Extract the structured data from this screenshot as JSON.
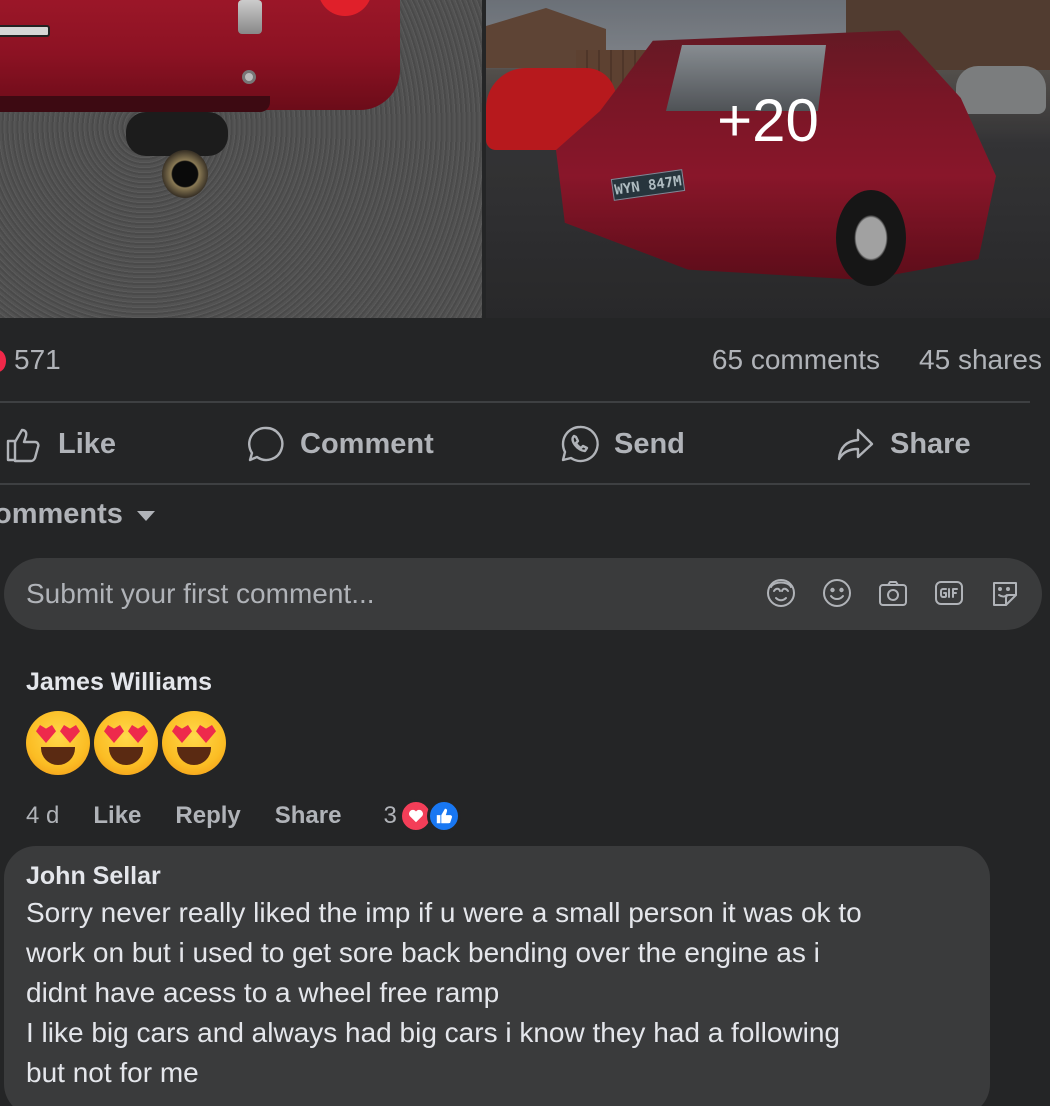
{
  "post": {
    "photos": {
      "more_label": "+20",
      "plate_text": "WYN 847M"
    },
    "stats": {
      "reactions": "571",
      "comments": "65 comments",
      "shares": "45 shares"
    },
    "actions": {
      "like": "Like",
      "comment": "Comment",
      "send": "Send",
      "share": "Share"
    },
    "sort_label": "omments",
    "composer": {
      "placeholder": "Submit your first comment..."
    }
  },
  "comments": [
    {
      "author": "James Williams",
      "body_emoji": [
        "heart-eyes-face",
        "heart-eyes-face",
        "heart-eyes-face"
      ],
      "time": "4 d",
      "like": "Like",
      "reply": "Reply",
      "share": "Share",
      "reaction_count": "3"
    },
    {
      "author": "John Sellar",
      "body": "Sorry never really liked the imp if u were a small person it was ok to\nwork on but i used to get sore back bending over the engine as i\ndidnt have acess to a wheel free ramp\nI like big cars and always had big cars i know they had a following\nbut not for me"
    }
  ],
  "colors": {
    "background": "#242526",
    "bubble": "#3a3b3c",
    "text_primary": "#e4e6eb",
    "text_secondary": "#b0b3b8",
    "like_blue": "#1877f2",
    "love_red": "#f33e58"
  }
}
